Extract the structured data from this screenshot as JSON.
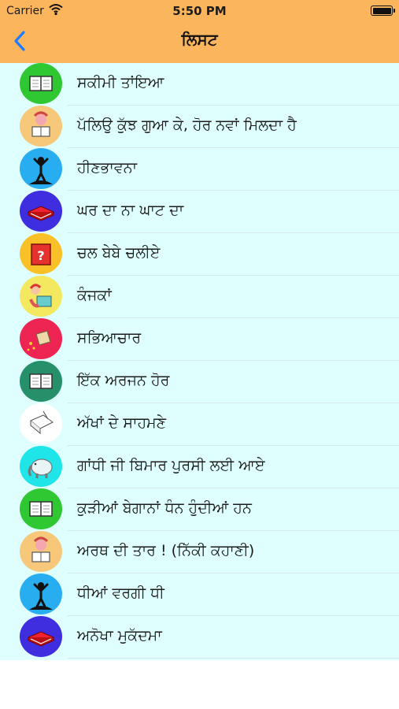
{
  "status_bar": {
    "carrier": "Carrier",
    "time": "5:50 PM"
  },
  "header": {
    "title": "ਲਿਸਟ",
    "back_icon": "chevron-left-icon",
    "background": "#fbb55c",
    "accent": "#1e7cff"
  },
  "list": {
    "background": "#dfffff",
    "items": [
      {
        "label": "ਸਕੀਮੀ ਤਾਂਇਆ",
        "icon": "open-book-icon",
        "color": "#2fc832"
      },
      {
        "label": "ਪੱਲਿਉ ਕੁੱਝ ਗੁਆ ਕੇ, ਹੋਰ ਨਵਾਂ ਮਿਲਦਾ ਹੈ",
        "icon": "girl-reading-icon",
        "color": "#f7c879"
      },
      {
        "label": "ਹੀਣਭਾਵਨਾ",
        "icon": "person-silhouette-icon",
        "color": "#28aef0"
      },
      {
        "label": "ਘਰ ਦਾ ਨਾ ਘਾਟ ਦਾ",
        "icon": "closed-book-icon",
        "color": "#3f2ee0"
      },
      {
        "label": "ਚਲ ਬੇਬੇ ਚਲੀਏ",
        "icon": "question-book-icon",
        "color": "#f9c127"
      },
      {
        "label": "ਕੰਜਕਾਂ",
        "icon": "child-reading-icon",
        "color": "#f3e85f"
      },
      {
        "label": "ਸਭਿਆਚਾਰ",
        "icon": "flying-book-icon",
        "color": "#ee2452"
      },
      {
        "label": "ਇੱਕ ਅਰਜਨ ਹੋਰ",
        "icon": "open-book-icon",
        "color": "#26906a"
      },
      {
        "label": "ਅੱਖਾਂ ਦੇ ਸਾਹਮਣੇ",
        "icon": "sketch-book-icon",
        "color": "#ffffff"
      },
      {
        "label": "ਗਾਂਧੀ ਜੀ ਬਿਮਾਰ ਪੁਰਸੀ ਲਈ ਆਏ",
        "icon": "elephant-icon",
        "color": "#1fe5e9"
      },
      {
        "label": "ਕੁੜੀਆਂ ਬੇਗਾਨਾਂ ਧੰਨ ਹੁੰਦੀਆਂ ਹਨ",
        "icon": "open-book-icon",
        "color": "#2fc832"
      },
      {
        "label": "ਅਰਥ ਦੀ ਤਾਰ ! (ਨਿੱਕੀ ਕਹਾਣੀ)",
        "icon": "girl-reading-icon",
        "color": "#f7c879"
      },
      {
        "label": "ਧੀਆਂ ਵਰਗੀ ਧੀ",
        "icon": "person-silhouette-icon",
        "color": "#28aef0"
      },
      {
        "label": "ਅਨੋਖਾ ਮੁਕੱਦਮਾ",
        "icon": "closed-book-icon",
        "color": "#3f2ee0"
      }
    ]
  }
}
